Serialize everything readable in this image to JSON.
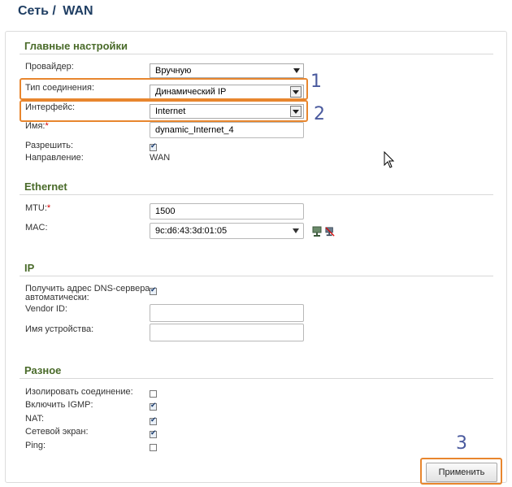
{
  "breadcrumb": {
    "network": "Сеть /",
    "page": "WAN"
  },
  "main_settings": {
    "title": "Главные настройки",
    "provider_label": "Провайдер:",
    "provider_value": "Вручную",
    "conn_type_label": "Тип соединения:",
    "conn_type_value": "Динамический IP",
    "interface_label": "Интерфейс:",
    "interface_value": "Internet",
    "name_label": "Имя:",
    "name_required": "*",
    "name_value": "dynamic_Internet_4",
    "enable_label": "Разрешить:",
    "enable_checked": true,
    "direction_label": "Направление:",
    "direction_value": "WAN"
  },
  "ethernet": {
    "title": "Ethernet",
    "mtu_label": "MTU:",
    "mtu_required": "*",
    "mtu_value": "1500",
    "mac_label": "MAC:",
    "mac_value": "9c:d6:43:3d:01:05"
  },
  "ip": {
    "title": "IP",
    "dns_auto_label_1": "Получить адрес DNS-сервера",
    "dns_auto_label_2": "автоматически:",
    "dns_auto_checked": true,
    "vendor_id_label": "Vendor ID:",
    "vendor_id_value": "",
    "device_name_label": "Имя устройства:",
    "device_name_value": ""
  },
  "misc": {
    "title": "Разное",
    "isolate_label": "Изолировать соединение:",
    "isolate_checked": false,
    "igmp_label": "Включить IGMP:",
    "igmp_checked": true,
    "nat_label": "NAT:",
    "nat_checked": true,
    "firewall_label": "Сетевой экран:",
    "firewall_checked": true,
    "ping_label": "Ping:",
    "ping_checked": false
  },
  "apply_label": "Применить",
  "annotations": {
    "one": "1",
    "two": "2",
    "three": "3"
  },
  "colors": {
    "highlight": "#e8862e",
    "annotation": "#4a5a9e",
    "section_title": "#4a6b2a",
    "title": "#1f3e63"
  }
}
